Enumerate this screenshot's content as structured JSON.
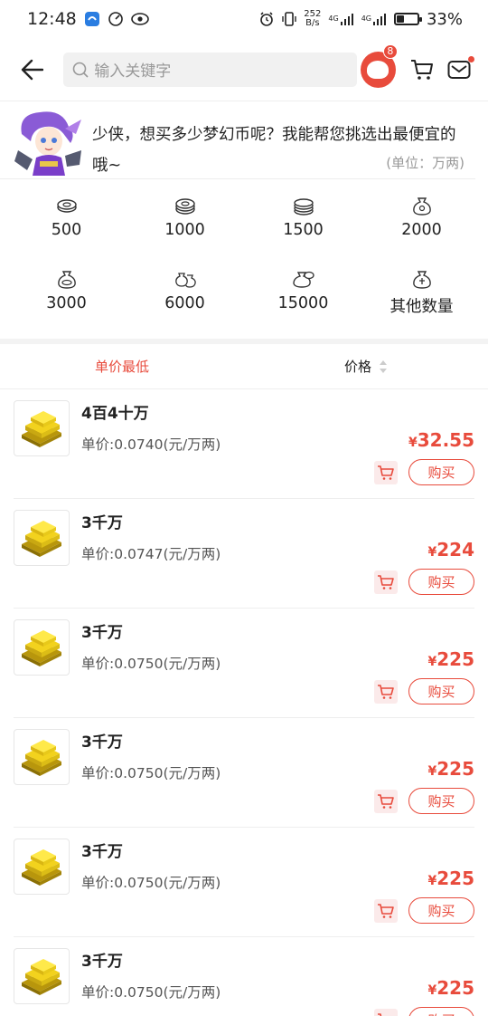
{
  "status": {
    "time": "12:48",
    "speed_top": "252",
    "speed_bottom": "B/s",
    "net1": "4G",
    "net2": "4G",
    "battery": "33%",
    "battery_level": 0.33
  },
  "header": {
    "search_placeholder": "输入关键字",
    "badge_count": "8"
  },
  "intro": {
    "text": "少侠，想买多少梦幻币呢？我能帮您挑选出最便宜的哦~",
    "unit": "(单位：万两)"
  },
  "amounts": [
    "500",
    "1000",
    "1500",
    "2000",
    "3000",
    "6000",
    "15000",
    "其他数量"
  ],
  "sort": {
    "lowest_unit": "单价最低",
    "price": "价格"
  },
  "items": [
    {
      "title": "4百4十万",
      "unit_price": "单价:0.0740(元/万两)",
      "currency": "¥",
      "price": "32.55",
      "buy": "购买"
    },
    {
      "title": "3千万",
      "unit_price": "单价:0.0747(元/万两)",
      "currency": "¥",
      "price": "224",
      "buy": "购买"
    },
    {
      "title": "3千万",
      "unit_price": "单价:0.0750(元/万两)",
      "currency": "¥",
      "price": "225",
      "buy": "购买"
    },
    {
      "title": "3千万",
      "unit_price": "单价:0.0750(元/万两)",
      "currency": "¥",
      "price": "225",
      "buy": "购买"
    },
    {
      "title": "3千万",
      "unit_price": "单价:0.0750(元/万两)",
      "currency": "¥",
      "price": "225",
      "buy": "购买"
    },
    {
      "title": "3千万",
      "unit_price": "单价:0.0750(元/万两)",
      "currency": "¥",
      "price": "225",
      "buy": "购买"
    }
  ],
  "colors": {
    "accent": "#e84b3c"
  }
}
